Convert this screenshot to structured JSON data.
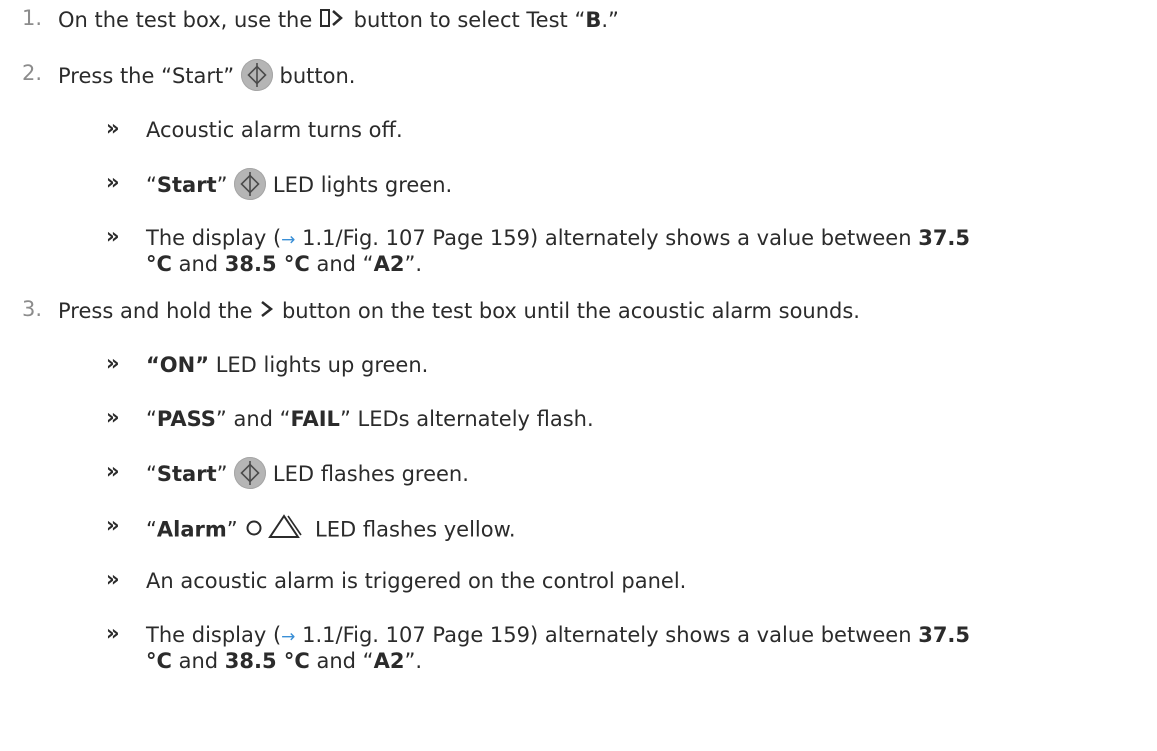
{
  "steps": [
    {
      "number": "1.",
      "before": "On the test box, use the",
      "after": "button to select Test “",
      "bold": "B",
      "end": ".”"
    },
    {
      "number": "2.",
      "before": "Press the “Start”",
      "after": "button."
    },
    {
      "number": "3.",
      "before": "Press and hold the",
      "after": "button on the test box until the acoustic alarm sounds."
    }
  ],
  "bullet_glyph": "»",
  "step2_results": {
    "r1": "Acoustic alarm turns off.",
    "r2": {
      "q1": "“",
      "bold": "Start",
      "q2": "”",
      "after": "LED lights green."
    },
    "r3": {
      "a": "The display (",
      "arrow": "→",
      "b": " 1.1/Fig. 107 Page 159) alternately shows a value between ",
      "v1": "37.5",
      "line2_unit1": "°C",
      "mid": " and ",
      "v2": "38.5 °C",
      "and": " and “",
      "code": "A2",
      "end": "”."
    }
  },
  "step3_results": {
    "r1": {
      "bold": "“ON”",
      "after": " LED lights up green."
    },
    "r2": {
      "q1": "“",
      "b1": "PASS",
      "mid": "” and “",
      "b2": "FAIL",
      "after": "” LEDs alternately flash."
    },
    "r3": {
      "q1": "“",
      "bold": "Start",
      "q2": "”",
      "after": "LED flashes green."
    },
    "r4": {
      "q1": "“",
      "bold": "Alarm",
      "q2": "”",
      "after": "LED flashes yellow."
    },
    "r5": "An acoustic alarm is triggered on the control panel.",
    "r6": {
      "a": "The display (",
      "arrow": "→",
      "b": " 1.1/Fig. 107 Page 159) alternately shows a value between ",
      "v1": "37.5",
      "line2_unit1": "°C",
      "mid": " and ",
      "v2": "38.5 °C",
      "and": " and “",
      "code": "A2",
      "end": "”."
    }
  },
  "icons": {
    "select": "select-button-icon",
    "start": "start-button-icon",
    "next": "chevron-right-icon",
    "alarm": "alarm-led-icon"
  }
}
